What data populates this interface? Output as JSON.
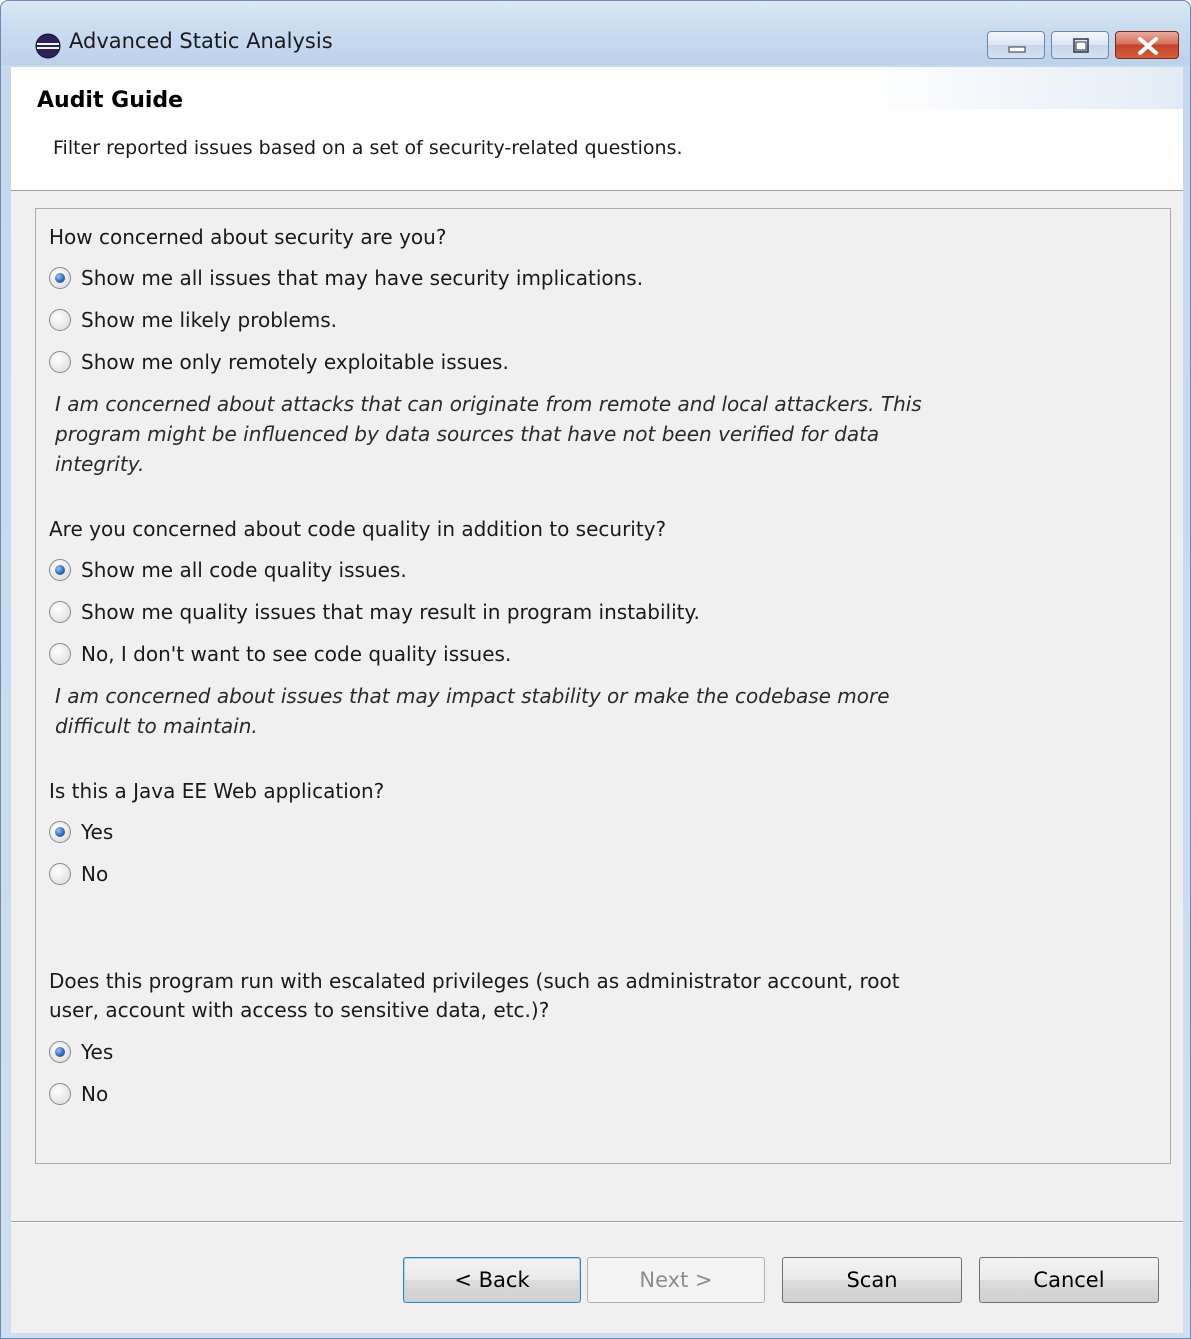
{
  "window": {
    "title": "Advanced Static Analysis",
    "app_icon": "eclipse-icon",
    "controls": {
      "minimize": "minimize-icon",
      "maximize": "maximize-icon",
      "close": "close-icon"
    }
  },
  "header": {
    "title": "Audit Guide",
    "description": "Filter reported issues based on a set of security-related questions."
  },
  "questions": [
    {
      "question": "How concerned about security are you?",
      "options": [
        {
          "label": "Show me all issues that may have security implications.",
          "checked": true
        },
        {
          "label": "Show me likely problems.",
          "checked": false
        },
        {
          "label": "Show me only remotely exploitable issues.",
          "checked": false
        }
      ],
      "hint": "I am concerned about attacks that can originate from remote and local attackers. This program might be influenced by data sources that have not been verified for data integrity."
    },
    {
      "question": "Are you concerned about code quality in addition to security?",
      "options": [
        {
          "label": "Show me all code quality issues.",
          "checked": true
        },
        {
          "label": "Show me quality issues that may result in program instability.",
          "checked": false
        },
        {
          "label": "No, I don't want to see code quality issues.",
          "checked": false
        }
      ],
      "hint": "I am concerned about issues that may impact stability or make the codebase more difficult to maintain."
    },
    {
      "question": "Is this a Java EE Web application?",
      "options": [
        {
          "label": "Yes",
          "checked": true
        },
        {
          "label": "No",
          "checked": false
        }
      ]
    },
    {
      "question": "Does this program run with escalated privileges (such as administrator account, root user, account with access to sensitive data, etc.)?",
      "options": [
        {
          "label": "Yes",
          "checked": true
        },
        {
          "label": "No",
          "checked": false
        }
      ]
    }
  ],
  "buttons": {
    "back": "< Back",
    "next": "Next >",
    "scan": "Scan",
    "cancel": "Cancel"
  }
}
